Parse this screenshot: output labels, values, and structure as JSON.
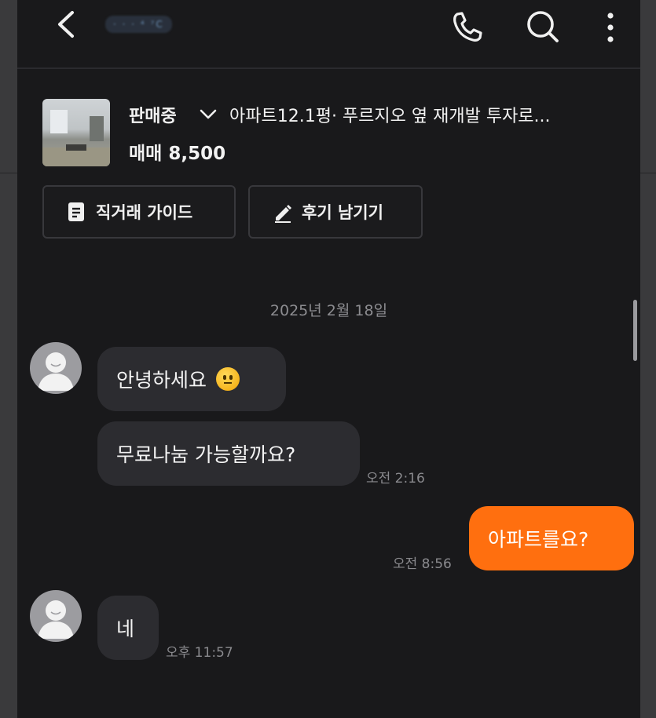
{
  "header": {
    "title_blurred": "· · ·  ⁴ ⁷C",
    "icons": [
      "back-arrow-icon",
      "phone-icon",
      "search-icon",
      "more-vertical-icon"
    ]
  },
  "product": {
    "status": "판매중",
    "title": "아파트12.1평· 푸르지오 옆 재개발 투자로...",
    "price": "매매 8,500"
  },
  "actions": {
    "guide_label": "직거래 가이드",
    "review_label": "후기 남기기"
  },
  "chat": {
    "date": "2025년 2월 18일",
    "messages": [
      {
        "sender": "other",
        "text": "안녕하세요",
        "emoji": "slightly-smiling-face"
      },
      {
        "sender": "other",
        "text": "무료나눔 가능할까요?",
        "time": "오전 2:16"
      },
      {
        "sender": "me",
        "text": "아파트를요?",
        "time": "오전 8:56"
      },
      {
        "sender": "other",
        "text": "네",
        "time": "오후 11:57"
      }
    ]
  },
  "colors": {
    "background": "#19191b",
    "bubble_other": "#2c2c30",
    "bubble_me": "#ff6f0f",
    "text": "#f2f2f2",
    "muted": "#8a8a8e"
  }
}
